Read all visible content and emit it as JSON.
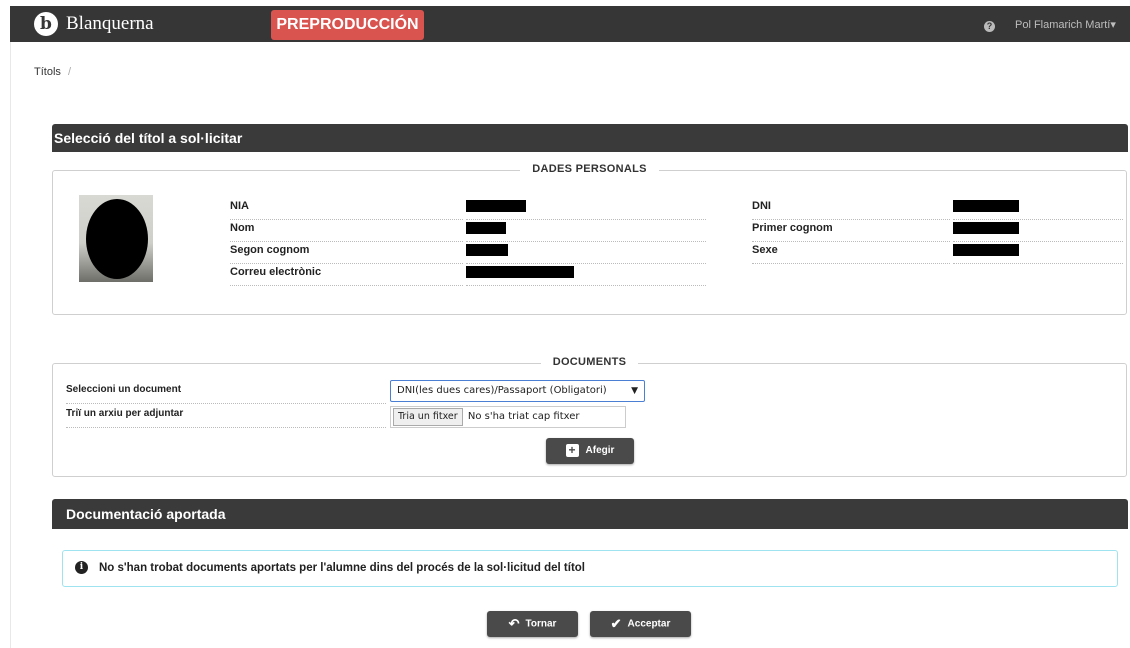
{
  "navbar": {
    "brand_logo": "b",
    "brand_name": "Blanquerna",
    "environment_badge": "PREPRODUCCIÓN",
    "help_icon": "?",
    "user_name": "Pol Flamarich Martí",
    "user_caret": "▾",
    "colors": {
      "bar": "#363636",
      "badge": "#d9534f"
    }
  },
  "breadcrumb": {
    "item": "Títols",
    "separator": "/"
  },
  "section_title": "Selecció del títol a sol·licitar",
  "personal": {
    "legend": "DADES PERSONALS",
    "photo_icon": "user-photo-redacted",
    "fields": {
      "nia": "NIA",
      "nom": "Nom",
      "segon_cognom": "Segon cognom",
      "correu": "Correu electrònic",
      "dni": "DNI",
      "primer_cognom": "Primer cognom",
      "sexe": "Sexe"
    }
  },
  "documents": {
    "legend": "DOCUMENTS",
    "select_label": "Seleccioni un document",
    "select_value": "DNI(les dues cares)/Passaport (Obligatori)",
    "select_caret": "▼",
    "file_label": "Triï un arxiu per adjuntar",
    "file_button": "Tria un fitxer",
    "file_status": "No s'ha triat cap fitxer",
    "add_button": "Afegir",
    "add_icon": "+"
  },
  "contributed": {
    "title": "Documentació aportada",
    "info_icon": "i",
    "message": "No s'han trobat documents aportats per l'alumne dins del procés de la sol·licitud del títol"
  },
  "actions": {
    "back_icon": "↶",
    "back_label": "Tornar",
    "accept_icon": "✔",
    "accept_label": "Acceptar"
  }
}
